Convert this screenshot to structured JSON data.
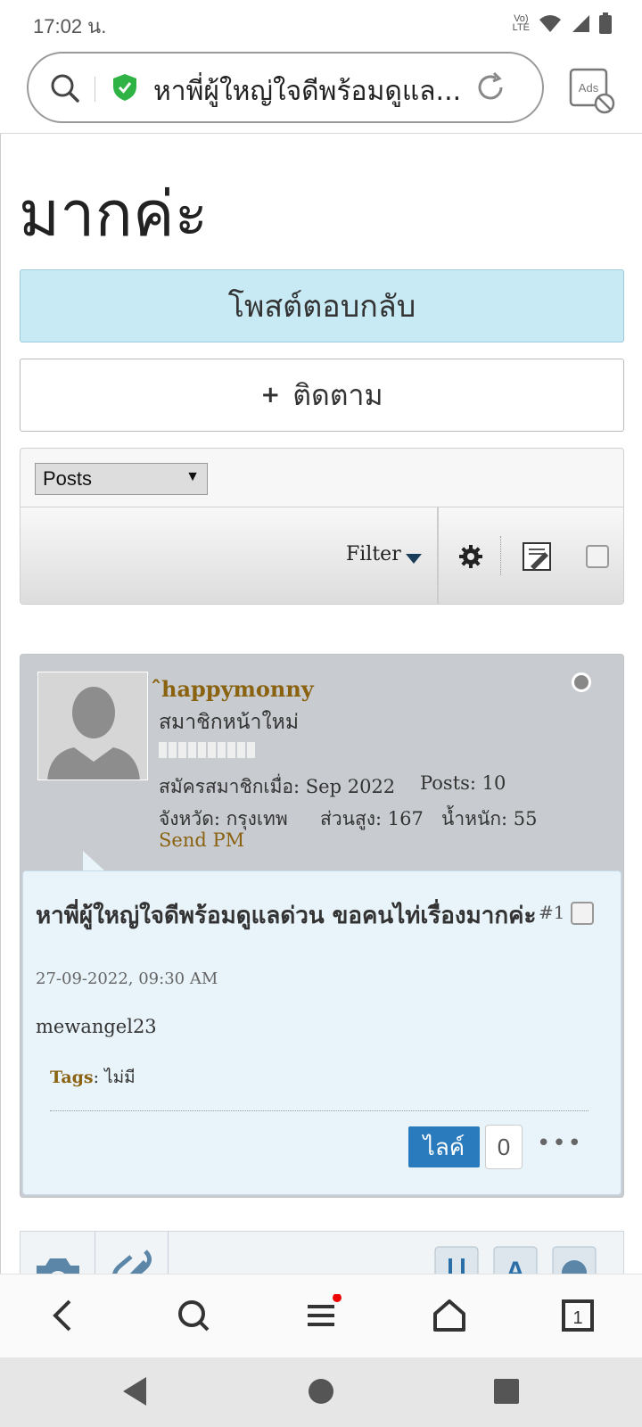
{
  "status_bar": {
    "time": "17:02 น.",
    "network_label": "LTE"
  },
  "url_bar": {
    "title": "หาพี่ผู้ใหญ่ใจดีพร้อมดูแล...",
    "ads_label": "Ads"
  },
  "page": {
    "title_fragment": "มากค่ะ",
    "reply_button": "โพสต์ตอบกลับ",
    "follow_button": "ติดตาม",
    "follow_plus": "+",
    "view_select": "Posts",
    "filter_label": "Filter"
  },
  "post": {
    "username": "ˆhappymonny",
    "user_title": "สมาชิกหน้าใหม่",
    "joined": "สมัครสมาชิกเมื่อ: Sep 2022",
    "posts": "Posts: 10",
    "province": "จังหวัด: กรุงเทพ",
    "height": "ส่วนสูง: 167",
    "weight": "น้ำหนัก: 55",
    "send_pm": "Send PM",
    "title": "หาพี่ผู้ใหญ่ใจดีพร้อมดูแลด่วน ขอคนไท่เรื่องมากค่ะ",
    "number": "#1",
    "date": "27-09-2022, 09:30 AM",
    "content": "mewangel23",
    "tags_label": "Tags",
    "tags_value": ": ไม่มี",
    "like_label": "ไลค์",
    "like_count": "0",
    "more": "•••"
  },
  "colors": {
    "accent": "#2a7bbd",
    "username": "#8a6210",
    "reply_bg": "#c8eaf5",
    "post_body": "#e8f3fa"
  },
  "icons": [
    "search-icon",
    "shield-icon",
    "reload-icon",
    "ads-block-icon",
    "gear-icon",
    "edit-icon",
    "camera-icon",
    "link-icon",
    "back-icon",
    "menu-icon",
    "home-icon",
    "tabs-icon"
  ]
}
